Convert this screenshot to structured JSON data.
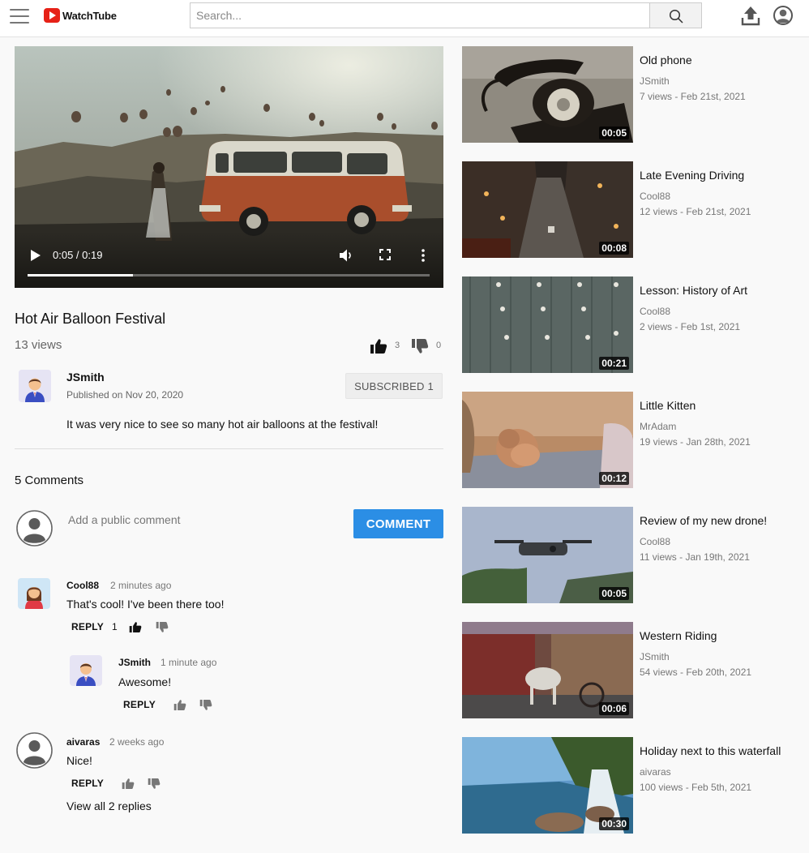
{
  "app": {
    "name": "WatchTube"
  },
  "search": {
    "placeholder": "Search..."
  },
  "player": {
    "time": "0:05 / 0:19",
    "progress": 0.263
  },
  "video": {
    "title": "Hot Air Balloon Festival",
    "views": "13 views",
    "likes": "3",
    "dislikes": "0",
    "uploader": "JSmith",
    "published": "Published on Nov 20, 2020",
    "subscribe_label": "SUBSCRIBED 1",
    "description": "It was very nice to see so many hot air balloons at the festival!"
  },
  "comments_section": {
    "count_label": "5 Comments",
    "input_placeholder": "Add a public comment",
    "button_label": "COMMENT"
  },
  "comments": [
    {
      "author": "Cool88",
      "time": "2 minutes ago",
      "text": "That's cool! I've been there too!",
      "reply_label": "REPLY",
      "likes": "1"
    },
    {
      "author": "JSmith",
      "time": "1 minute ago",
      "text": "Awesome!",
      "reply_label": "REPLY"
    },
    {
      "author": "aivaras",
      "time": "2 weeks ago",
      "text": "Nice!",
      "reply_label": "REPLY",
      "view_replies": "View all 2 replies"
    }
  ],
  "recommended": [
    {
      "title": "Old phone",
      "channel": "JSmith",
      "meta": "7 views - Feb 21st, 2021",
      "duration": "00:05"
    },
    {
      "title": "Late Evening Driving",
      "channel": "Cool88",
      "meta": "12 views - Feb 21st, 2021",
      "duration": "00:08"
    },
    {
      "title": "Lesson: History of Art",
      "channel": "Cool88",
      "meta": "2 views - Feb 1st, 2021",
      "duration": "00:21"
    },
    {
      "title": "Little Kitten",
      "channel": "MrAdam",
      "meta": "19 views - Jan 28th, 2021",
      "duration": "00:12"
    },
    {
      "title": "Review of my new drone!",
      "channel": "Cool88",
      "meta": "11 views - Jan 19th, 2021",
      "duration": "00:05"
    },
    {
      "title": "Western Riding",
      "channel": "JSmith",
      "meta": "54 views - Feb 20th, 2021",
      "duration": "00:06"
    },
    {
      "title": "Holiday next to this waterfall",
      "channel": "aivaras",
      "meta": "100 views - Feb 5th, 2021",
      "duration": "00:30"
    }
  ],
  "icons": {
    "menu": "hamburger-icon",
    "logo": "play-logo-icon",
    "search": "search-icon",
    "upload": "upload-icon",
    "account": "account-icon",
    "like": "thumbs-up-icon",
    "dislike": "thumbs-down-icon",
    "volume": "volume-icon",
    "fullscreen": "fullscreen-icon",
    "more": "more-vert-icon"
  },
  "colors": {
    "brand": "#e62117",
    "accent": "#2b8ee5"
  }
}
